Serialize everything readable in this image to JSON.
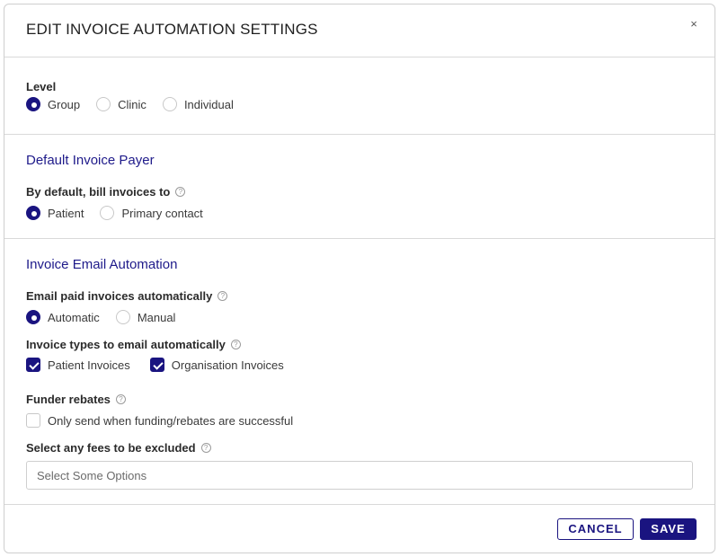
{
  "modal": {
    "title": "EDIT INVOICE AUTOMATION SETTINGS",
    "close_label": "×"
  },
  "level": {
    "label": "Level",
    "options": [
      "Group",
      "Clinic",
      "Individual"
    ],
    "selected": "Group"
  },
  "payer": {
    "section_title": "Default Invoice Payer",
    "label": "By default, bill invoices to",
    "options": [
      "Patient",
      "Primary contact"
    ],
    "selected": "Patient"
  },
  "email": {
    "section_title": "Invoice Email Automation",
    "paid_label": "Email paid invoices automatically",
    "paid_options": [
      "Automatic",
      "Manual"
    ],
    "paid_selected": "Automatic",
    "types_label": "Invoice types to email automatically",
    "types_options": [
      "Patient Invoices",
      "Organisation Invoices"
    ],
    "types_checked": [
      true,
      true
    ],
    "rebates_label": "Funder rebates",
    "rebates_option": "Only send when funding/rebates are successful",
    "rebates_checked": false,
    "fees_label": "Select any fees to be excluded",
    "fees_placeholder": "Select Some Options"
  },
  "footer": {
    "cancel_label": "CANCEL",
    "save_label": "SAVE"
  },
  "colors": {
    "accent": "#1a1480",
    "section_title": "#1e1a8a",
    "border": "#d9d9d9"
  },
  "icons": {
    "help": "question-circle-icon",
    "close": "close-icon"
  }
}
